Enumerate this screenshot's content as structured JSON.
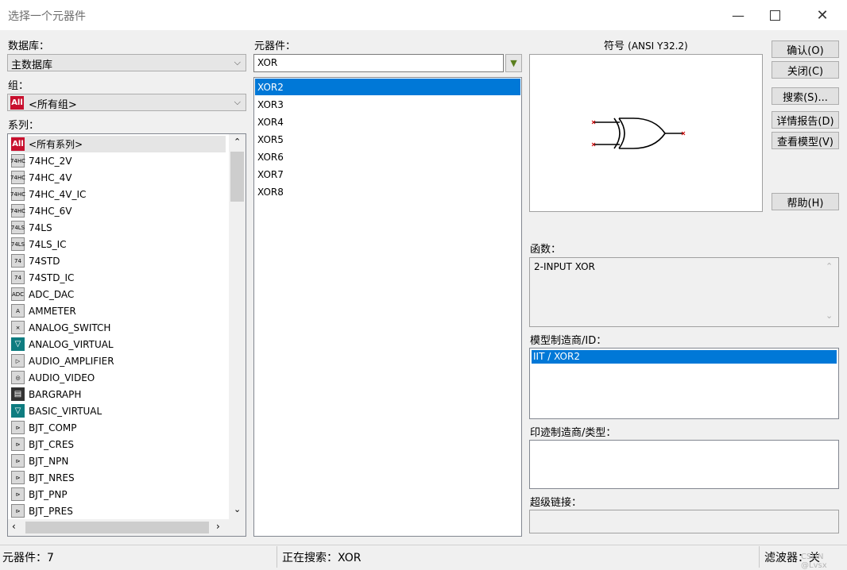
{
  "window": {
    "title": "选择一个元器件"
  },
  "database": {
    "label": "数据库：",
    "value": "主数据库"
  },
  "group": {
    "label": "组：",
    "icon_text": "All",
    "value": "<所有组>"
  },
  "family": {
    "label": "系列：",
    "items": [
      {
        "label": "<所有系列>",
        "icon": "all-icon",
        "icon_text": "All"
      },
      {
        "label": "74HC_2V",
        "icon": "74hc-icon",
        "icon_text": "74HC"
      },
      {
        "label": "74HC_4V",
        "icon": "74hc-icon",
        "icon_text": "74HC"
      },
      {
        "label": "74HC_4V_IC",
        "icon": "74hc-icon",
        "icon_text": "74HC"
      },
      {
        "label": "74HC_6V",
        "icon": "74hc-icon",
        "icon_text": "74HC"
      },
      {
        "label": "74LS",
        "icon": "74ls-icon",
        "icon_text": "74LS"
      },
      {
        "label": "74LS_IC",
        "icon": "74ls-icon",
        "icon_text": "74LS"
      },
      {
        "label": "74STD",
        "icon": "74std-icon",
        "icon_text": "74"
      },
      {
        "label": "74STD_IC",
        "icon": "74std-icon",
        "icon_text": "74"
      },
      {
        "label": "ADC_DAC",
        "icon": "adc-icon",
        "icon_text": "ADC"
      },
      {
        "label": "AMMETER",
        "icon": "ammeter-icon",
        "icon_text": "A"
      },
      {
        "label": "ANALOG_SWITCH",
        "icon": "switch-icon",
        "icon_text": "⨯"
      },
      {
        "label": "ANALOG_VIRTUAL",
        "icon": "virtual-icon",
        "icon_text": "▽"
      },
      {
        "label": "AUDIO_AMPLIFIER",
        "icon": "amplifier-icon",
        "icon_text": "▷"
      },
      {
        "label": "AUDIO_VIDEO",
        "icon": "audio-video-icon",
        "icon_text": "◎"
      },
      {
        "label": "BARGRAPH",
        "icon": "bargraph-icon",
        "icon_text": "▤"
      },
      {
        "label": "BASIC_VIRTUAL",
        "icon": "virtual-icon",
        "icon_text": "▽"
      },
      {
        "label": "BJT_COMP",
        "icon": "bjt-icon",
        "icon_text": "⊳"
      },
      {
        "label": "BJT_CRES",
        "icon": "bjt-icon",
        "icon_text": "⊳"
      },
      {
        "label": "BJT_NPN",
        "icon": "bjt-icon",
        "icon_text": "⊳"
      },
      {
        "label": "BJT_NRES",
        "icon": "bjt-icon",
        "icon_text": "⊳"
      },
      {
        "label": "BJT_PNP",
        "icon": "bjt-icon",
        "icon_text": "⊳"
      },
      {
        "label": "BJT_PRES",
        "icon": "bjt-icon",
        "icon_text": "⊳"
      }
    ]
  },
  "component": {
    "label": "元器件：",
    "search_value": "XOR",
    "items": [
      "XOR2",
      "XOR3",
      "XOR4",
      "XOR5",
      "XOR6",
      "XOR7",
      "XOR8"
    ],
    "selected": "XOR2"
  },
  "symbol": {
    "label": "符号",
    "standard": "(ANSI Y32.2)"
  },
  "buttons": {
    "ok": "确认(O)",
    "close": "关闭(C)",
    "search": "搜索(S)...",
    "detail_report": "详情报告(D)",
    "view_model": "查看模型(V)",
    "help": "帮助(H)"
  },
  "function": {
    "label": "函数：",
    "value": "2-INPUT XOR"
  },
  "model_manufacturer": {
    "label": "模型制造商/ID：",
    "items": [
      "IIT / XOR2"
    ]
  },
  "footprint": {
    "label": "印迹制造商/类型："
  },
  "hyperlink": {
    "label": "超级链接："
  },
  "status": {
    "components": "元器件：7",
    "searching": "正在搜索：XOR",
    "filter": "滤波器：关",
    "watermark": "CSDN @Lvsx"
  },
  "colors": {
    "accent": "#0078d7",
    "all_badge": "#c8102e",
    "symbol_marker": "#cc0000"
  }
}
